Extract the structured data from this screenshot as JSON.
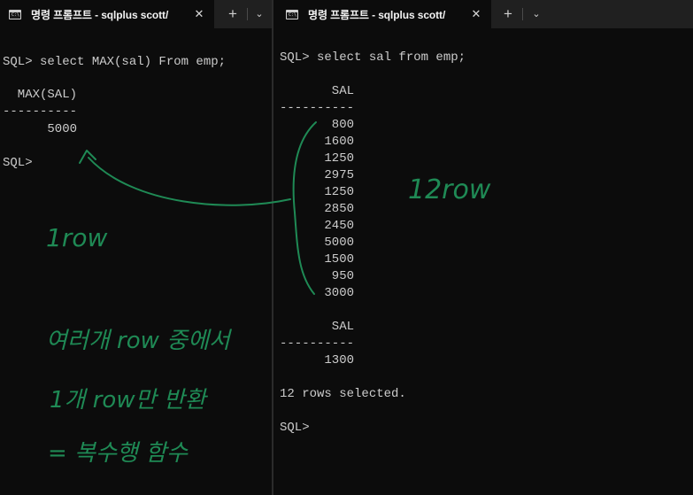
{
  "left_pane": {
    "tab_title": "명령 프롬프트 - sqlplus  scott/",
    "tab_close": "✕",
    "new_tab": "+",
    "dropdown": "⌄",
    "lines": [
      "SQL> select MAX(sal) From emp;",
      "",
      "  MAX(SAL)",
      "----------",
      "      5000",
      "",
      "SQL>"
    ],
    "annotations": {
      "row_count": "1row",
      "note_line1": "여러개 row 중에서",
      "note_line2": "1개 row만 반환",
      "note_line3": "= 복수행 함수"
    }
  },
  "right_pane": {
    "tab_title": "명령 프롬프트 - sqlplus  scott/",
    "tab_close": "✕",
    "new_tab": "+",
    "dropdown": "⌄",
    "query_line": "SQL> select sal from emp;",
    "header1": "       SAL",
    "separator1": "----------",
    "rows": [
      "       800",
      "      1600",
      "      1250",
      "      2975",
      "      1250",
      "      2850",
      "      2450",
      "      5000",
      "      1500",
      "       950",
      "      3000"
    ],
    "header2": "       SAL",
    "separator2": "----------",
    "last_row": "      1300",
    "summary": "12 rows selected.",
    "prompt": "SQL>",
    "annotations": {
      "row_count": "12row"
    }
  },
  "colors": {
    "terminal_bg": "#0c0c0c",
    "terminal_text": "#cccccc",
    "tab_bar_bg": "#202020",
    "annotation_ink": "#1f8a55"
  },
  "icons": [
    "cmd-icon",
    "close-icon",
    "plus-icon",
    "chevron-down-icon"
  ]
}
